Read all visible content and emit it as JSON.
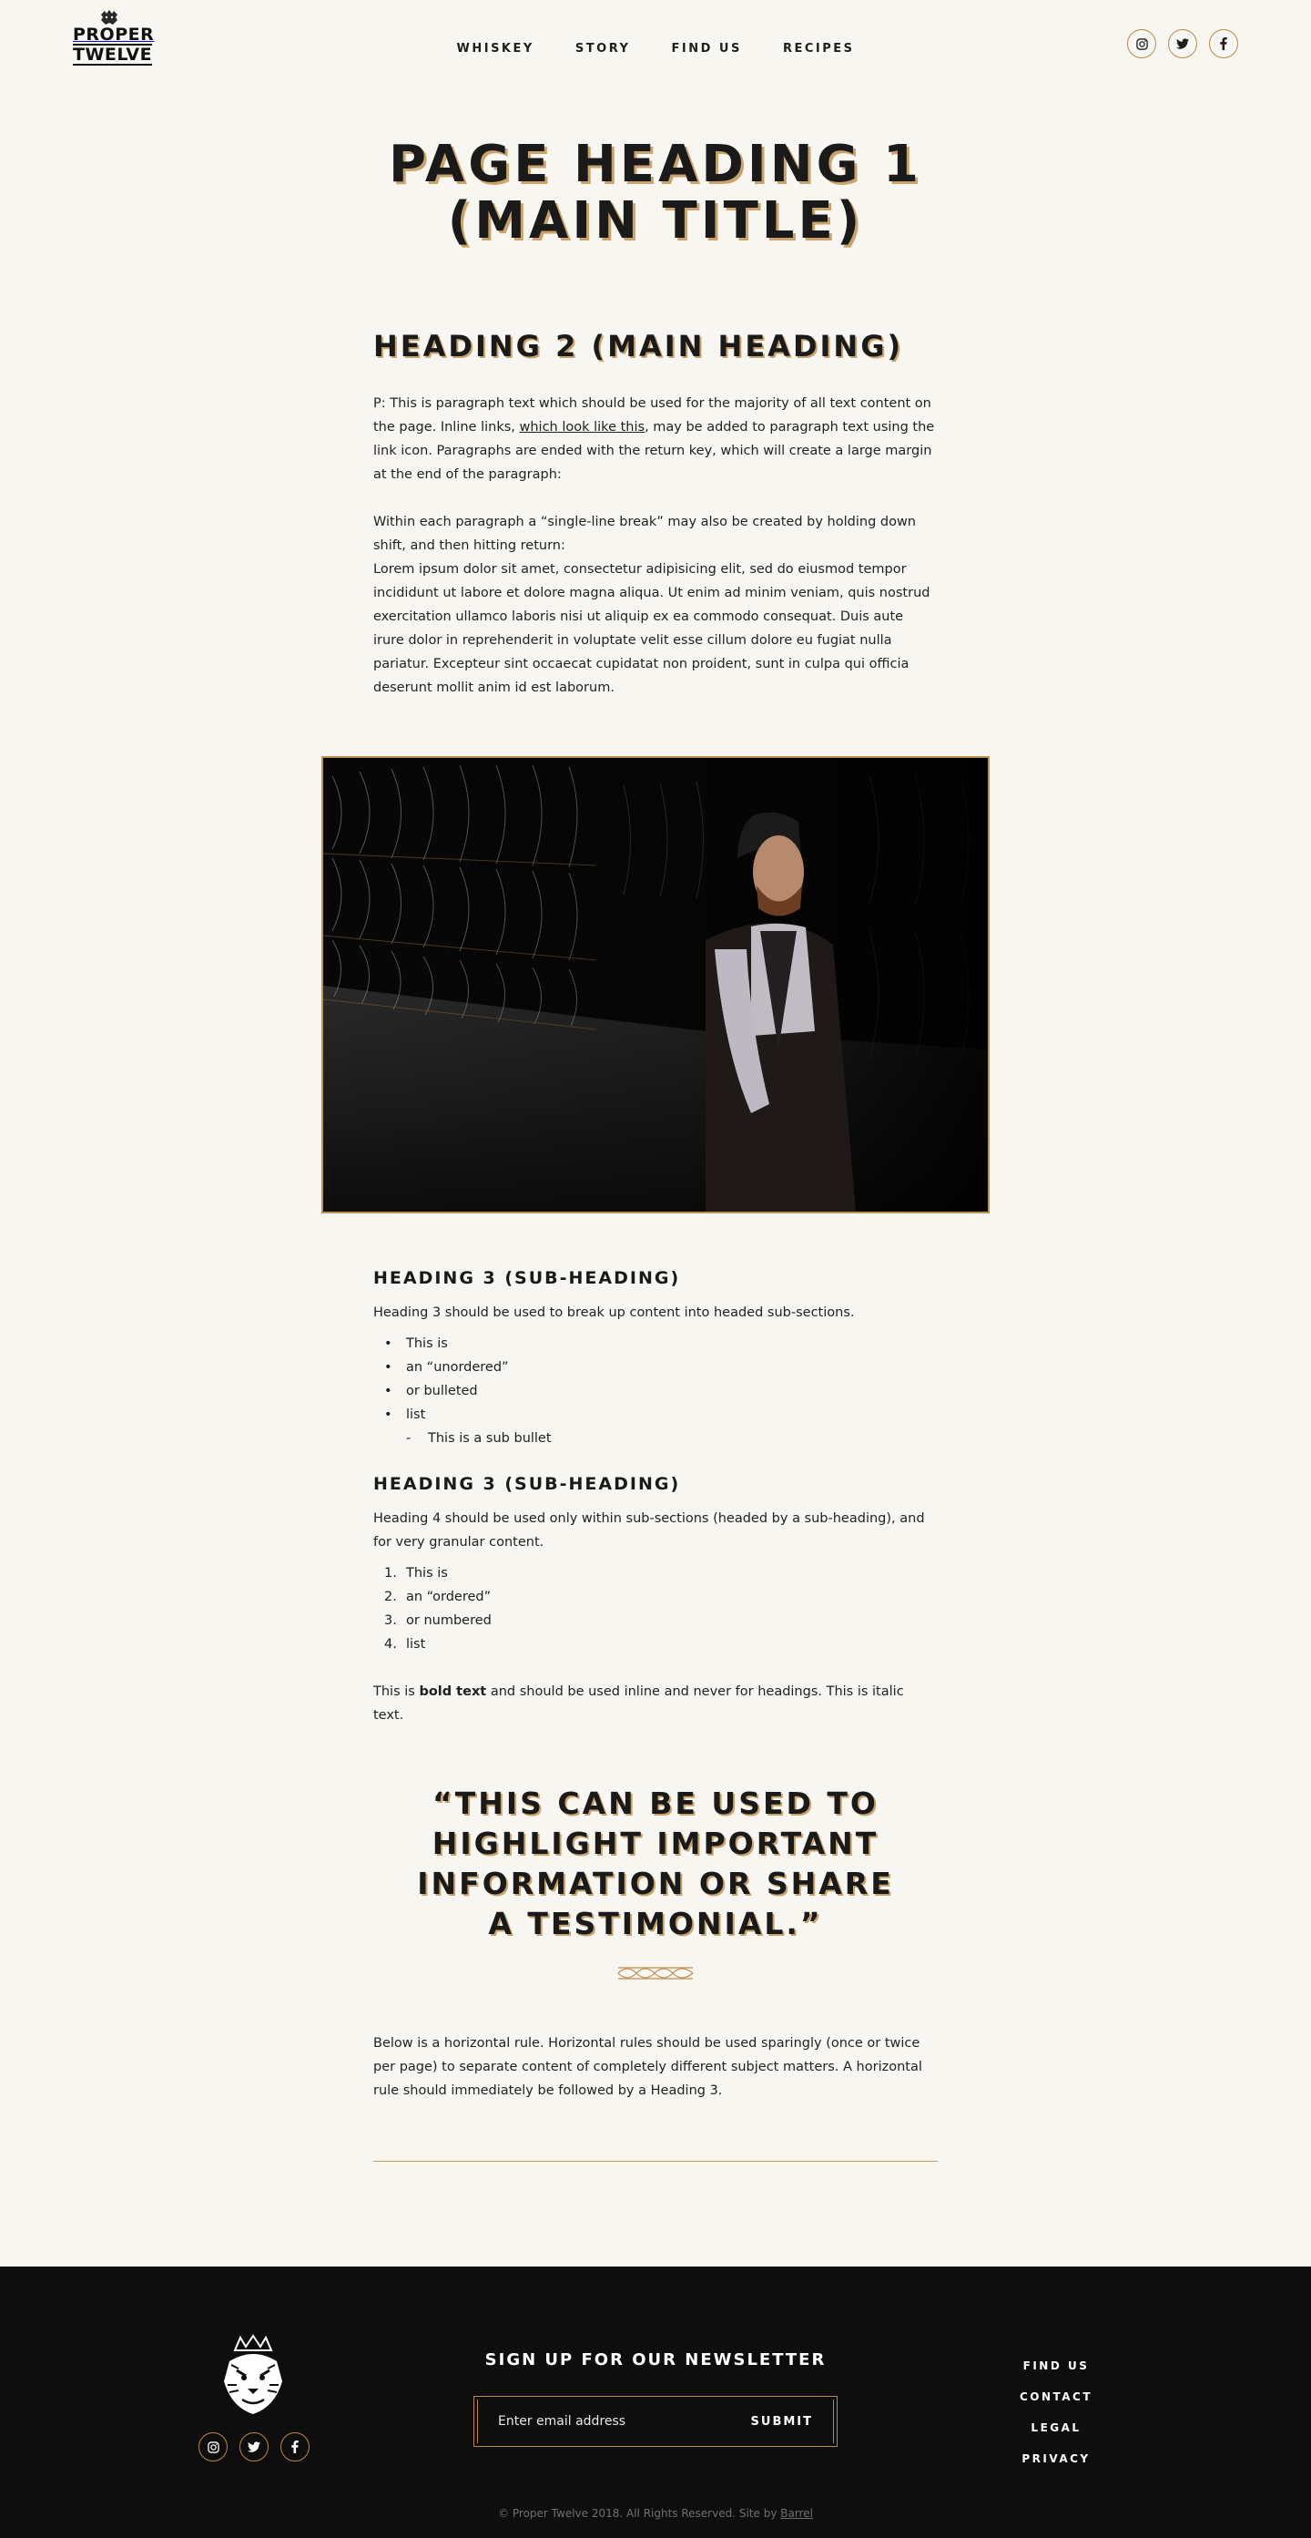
{
  "header": {
    "logo": {
      "line1": "PROPER",
      "line2": "TWELVE"
    },
    "nav": [
      "WHISKEY",
      "STORY",
      "FIND US",
      "RECIPES"
    ],
    "social": [
      "instagram-icon",
      "twitter-icon",
      "facebook-icon"
    ]
  },
  "main": {
    "page_heading": "PAGE HEADING 1 (MAIN TITLE)",
    "heading2": "HEADING 2 (MAIN HEADING)",
    "para1_before_link": "P: This is paragraph text which should be used for the majority of all text content on the page. Inline links, ",
    "para1_link": "which look like this",
    "para1_after_link": ", may be added to paragraph text using the link icon. Paragraphs are ended with the return key, which will create a large margin at the end of the paragraph:",
    "para2_line1": "Within each paragraph a “single-line break” may also be created by holding down shift, and then hitting return:",
    "para2_line2": "Lorem ipsum dolor sit amet, consectetur adipisicing elit, sed do eiusmod tempor incididunt ut labore et dolore magna aliqua. Ut enim ad minim veniam, quis nostrud exercitation ullamco laboris nisi ut aliquip ex ea commodo consequat. Duis aute irure dolor in reprehenderit in voluptate velit esse cillum dolore eu fugiat nulla pariatur. Excepteur sint occaecat cupidatat non proident, sunt in culpa qui officia deserunt mollit anim id est laborum.",
    "subheading1": "HEADING 3 (SUB-HEADING)",
    "sub1_text": "Heading 3 should be used to break up content into headed sub-sections.",
    "bullets": [
      "This is",
      "an “unordered”",
      "or bulleted",
      "list"
    ],
    "sub_bullet": "This is a sub bullet",
    "subheading2": "HEADING 3 (SUB-HEADING)",
    "sub2_text": "Heading 4 should be used only within sub-sections (headed by a sub-heading), and for very granular content.",
    "ordered": [
      {
        "n": "1.",
        "text": "This is"
      },
      {
        "n": "2.",
        "text": "an “ordered”"
      },
      {
        "n": "3.",
        "text": "or numbered"
      },
      {
        "n": "4.",
        "text": "list"
      }
    ],
    "bold_before": "This is ",
    "bold_text": "bold text",
    "bold_after": " and should be used inline and never for headings. This is italic text.",
    "quote": "“THIS CAN BE USED TO HIGHLIGHT IMPORTANT INFORMATION OR SHARE A TESTIMONIAL.”",
    "hr_note": "Below is a horizontal rule. Horizontal rules should be used sparingly (once or twice per page) to separate content of completely different subject matters. A horizontal rule should immediately be followed by a Heading 3."
  },
  "footer": {
    "newsletter_title": "SIGN UP FOR OUR NEWSLETTER",
    "email_placeholder": "Enter email address",
    "submit_label": "SUBMIT",
    "links": [
      "FIND US",
      "CONTACT",
      "LEGAL",
      "PRIVACY"
    ],
    "copyright_text": "© Proper Twelve 2018. All Rights Reserved. Site by ",
    "credit_link": "Barrel",
    "social": [
      "instagram-icon",
      "twitter-icon",
      "facebook-icon"
    ]
  },
  "colors": {
    "background": "#f8f6f1",
    "accent_gold": "#c09050",
    "footer_bg": "#0e0e0e",
    "text": "#1e1e1e"
  }
}
